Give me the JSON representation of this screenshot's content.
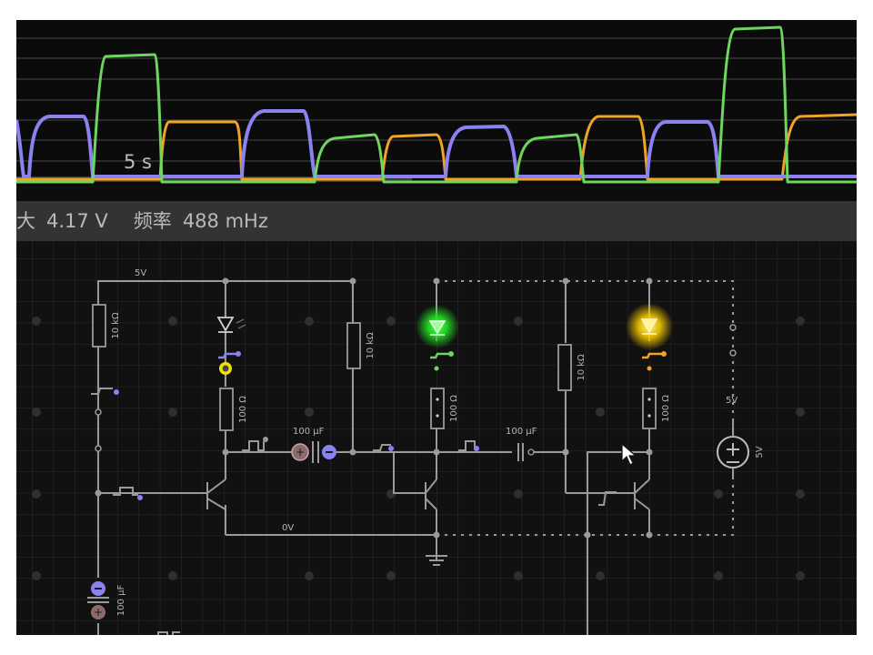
{
  "scope": {
    "time_scale": "5 s",
    "trace_colors": {
      "purple": "#8a82f0",
      "green": "#6cd65e",
      "orange": "#f0a424"
    }
  },
  "readout": {
    "max_label": "大",
    "max_value": "4.17 V",
    "freq_label": "频率",
    "freq_value": "488 mHz"
  },
  "circuit": {
    "supply_label": "5V",
    "ground_label": "0V",
    "resistors": {
      "r_left": "10 kΩ",
      "r_led1": "100 Ω",
      "r_mid": "10 kΩ",
      "r_led2": "100 Ω",
      "r_right": "10 kΩ",
      "r_led3": "100 Ω"
    },
    "capacitors": {
      "c1": "100 µF",
      "c2": "100 µF",
      "c3": "100 µF"
    },
    "source": {
      "top_label": "5V",
      "side_label": "5V"
    },
    "led_colors": {
      "led1": "#dddddd",
      "led2": "#3cf03c",
      "led3": "#f5c800"
    }
  }
}
